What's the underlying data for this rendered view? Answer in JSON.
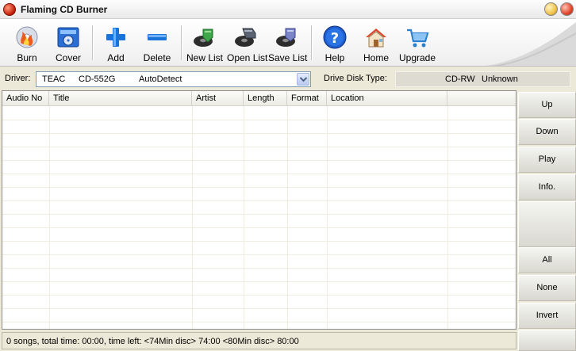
{
  "window": {
    "title": "Flaming CD Burner"
  },
  "toolbar": {
    "buttons": [
      {
        "label": "Burn",
        "icon": "burn-cd-icon"
      },
      {
        "label": "Cover",
        "icon": "cover-icon"
      },
      {
        "label": "Add",
        "icon": "plus-icon"
      },
      {
        "label": "Delete",
        "icon": "minus-icon"
      },
      {
        "label": "New List",
        "icon": "new-list-icon"
      },
      {
        "label": "Open List",
        "icon": "open-list-icon"
      },
      {
        "label": "Save List",
        "icon": "save-list-icon"
      },
      {
        "label": "Help",
        "icon": "help-icon"
      },
      {
        "label": "Home",
        "icon": "home-icon"
      },
      {
        "label": "Upgrade",
        "icon": "cart-icon"
      }
    ]
  },
  "driver": {
    "label": "Driver:",
    "selected": {
      "vendor": "TEAC",
      "model": "CD-552G",
      "mode": "AutoDetect"
    },
    "disk_type_label": "Drive Disk Type:",
    "disk_type": {
      "media": "CD-RW",
      "status": "Unknown"
    }
  },
  "song_list": {
    "columns": [
      "Audio No",
      "Title",
      "Artist",
      "Length",
      "Format",
      "Location"
    ],
    "rows": []
  },
  "side_buttons": {
    "up": "Up",
    "down": "Down",
    "play": "Play",
    "info": "Info.",
    "all": "All",
    "none": "None",
    "invert": "Invert"
  },
  "status": {
    "text": "0 songs, total time: 00:00, time left: <74Min disc> 74:00 <80Min disc> 80:00"
  },
  "colors": {
    "titlebar_bg": "#f6f6f6",
    "toolbar_bg": "#ffffff",
    "window_bg": "#ece9d8",
    "list_bg": "#ffffff",
    "accent_blue": "#1a73d9",
    "close_red": "#e2452a"
  }
}
